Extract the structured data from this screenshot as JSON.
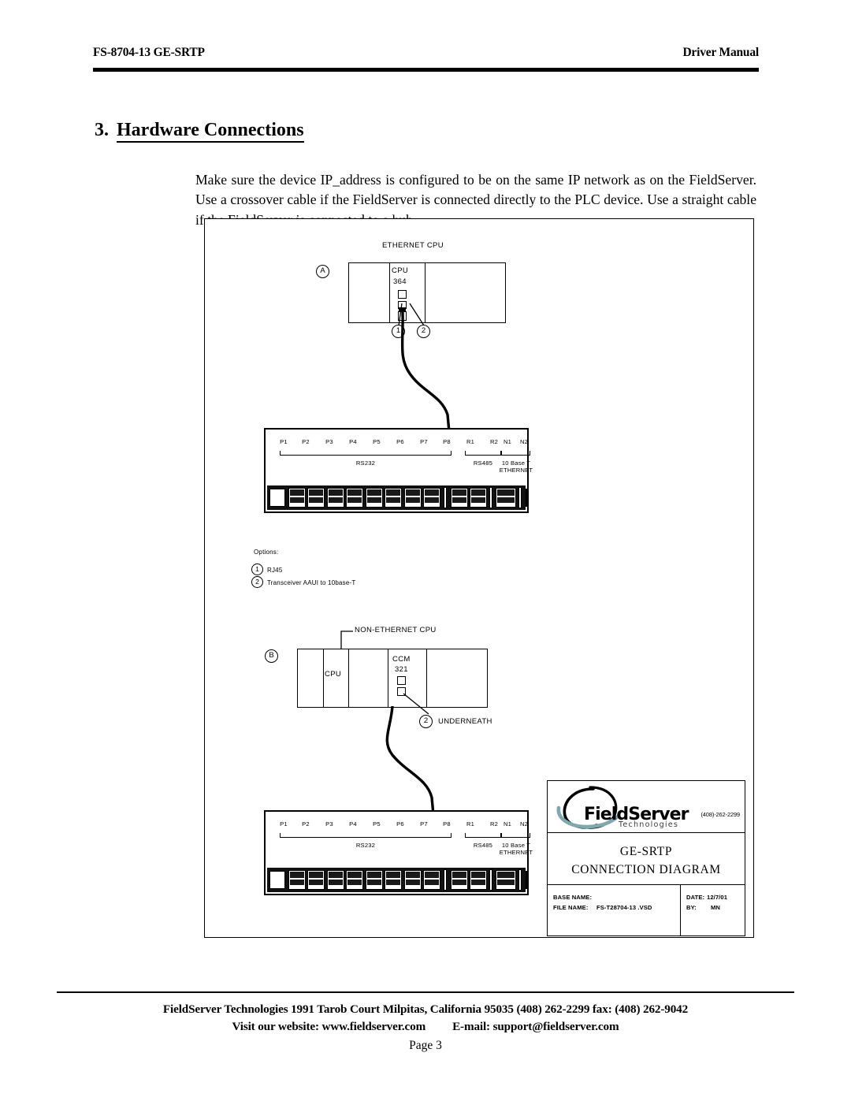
{
  "header": {
    "left": "FS-8704-13 GE-SRTP",
    "right": "Driver Manual"
  },
  "section": {
    "number": "3.",
    "title": "Hardware Connections",
    "paragraph": "Make sure the device IP_address is configured to be on the same IP network as on the FieldServer. Use a crossover cable if the FieldServer is connected directly to the PLC device. Use a straight cable if the FieldServer is connected to a hub."
  },
  "diagram": {
    "ethernet_cpu": {
      "caption": "ETHERNET CPU",
      "balloon": "A",
      "module_name": "CPU",
      "module_number": "364",
      "callouts": [
        "1",
        "2"
      ]
    },
    "non_ethernet_cpu": {
      "caption": "NON-ETHERNET CPU",
      "balloon": "B",
      "cpu_label": "CPU",
      "module_name": "CCM",
      "module_number": "321",
      "callout": "2",
      "callout_label": "UNDERNEATH"
    },
    "options": {
      "heading": "Options:",
      "items": [
        {
          "num": "1",
          "label": "RJ45"
        },
        {
          "num": "2",
          "label": "Transceiver AAUI to 10base-T"
        }
      ]
    },
    "fieldserver_unit": {
      "rs232_pins": [
        "P1",
        "P2",
        "P3",
        "P4",
        "P5",
        "P6",
        "P7",
        "P8"
      ],
      "rs232_group": "RS232",
      "rs485_pins": [
        "R1",
        "R2"
      ],
      "rs485_group": "RS485",
      "ethernet_pins": [
        "N1",
        "N2"
      ],
      "ethernet_group_line1": "10 Base T",
      "ethernet_group_line2": "ETHERNET"
    },
    "title_block": {
      "logo_name": "FieldServer",
      "logo_sub": "Technologies",
      "phone": "(408)-262-2299",
      "title_line1": "GE-SRTP",
      "title_line2": "CONNECTION DIAGRAM",
      "base_name_label": "BASE NAME:",
      "file_name_label": "FILE NAME:",
      "file_name_value": "FS-T28704-13 .VSD",
      "date_label": "DATE:",
      "date_value": "12/7/01",
      "by_label": "BY:",
      "by_value": "MN"
    }
  },
  "footer": {
    "line1": "FieldServer Technologies 1991 Tarob Court Milpitas, California 95035 (408) 262-2299 fax: (408) 262-9042",
    "line2_a": "Visit our website: www.fieldserver.com",
    "line2_b": "E-mail: support@fieldserver.com",
    "page": "Page 3"
  },
  "colors": {
    "ink": "#000000",
    "logo_swoosh": "#7fa8b0",
    "paper": "#ffffff"
  }
}
